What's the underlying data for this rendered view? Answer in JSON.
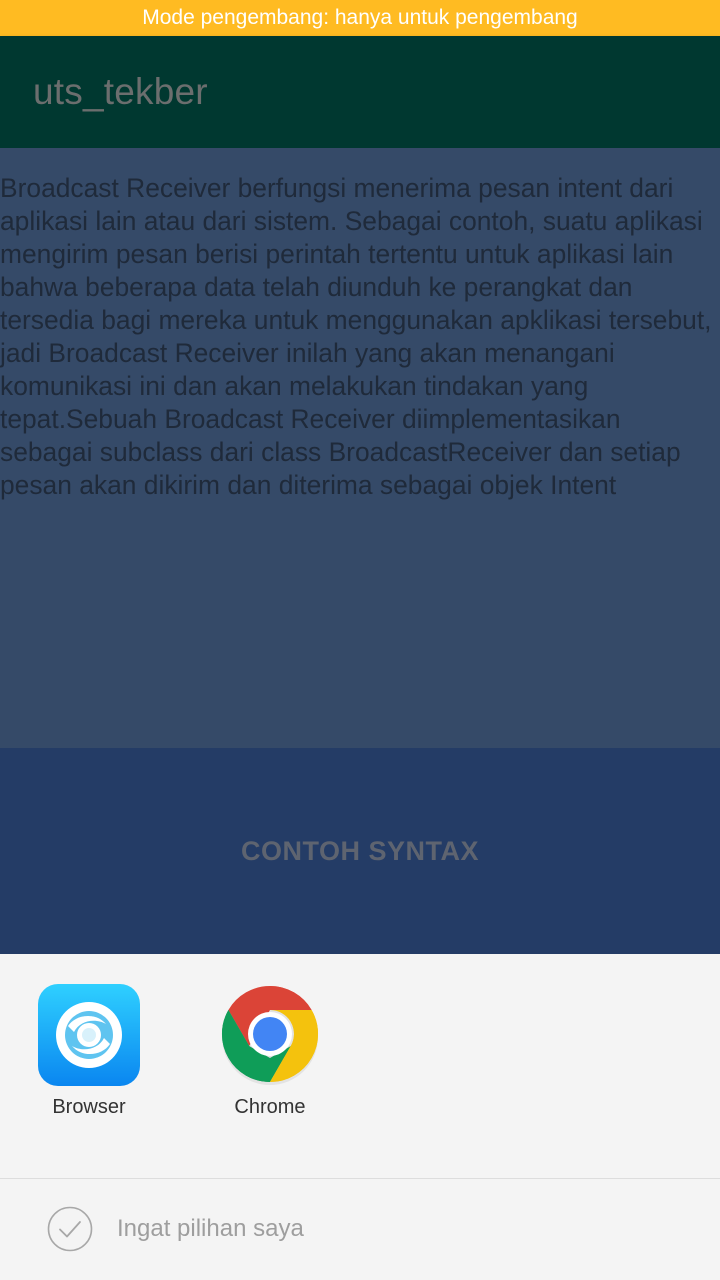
{
  "dev_banner": {
    "text": "Mode pengembang: hanya untuk pengembang"
  },
  "app_bar": {
    "title": "uts_tekber"
  },
  "content": {
    "body_text": "Broadcast Receiver berfungsi menerima pesan intent dari aplikasi lain atau dari sistem. Sebagai contoh, suatu aplikasi mengirim pesan berisi perintah tertentu untuk aplikasi lain bahwa beberapa data telah diunduh ke perangkat dan tersedia bagi mereka untuk menggunakan apklikasi tersebut, jadi Broadcast Receiver inilah yang akan menangani komunikasi ini dan akan melakukan tindakan yang tepat.Sebuah Broadcast Receiver diimplementasikan sebagai subclass dari class BroadcastReceiver dan setiap pesan akan dikirim dan diterima sebagai objek Intent"
  },
  "button": {
    "label": "CONTOH SYNTAX"
  },
  "chooser": {
    "apps": [
      {
        "label": "Browser",
        "icon": "browser-icon"
      },
      {
        "label": "Chrome",
        "icon": "chrome-icon"
      }
    ],
    "remember_label": "Ingat pilihan saya"
  },
  "colors": {
    "dev_banner": "#ffbb22",
    "app_bar": "#003830",
    "content_bg": "#354a68",
    "button_bg": "#243c66",
    "sheet_bg": "#f4f4f4"
  }
}
